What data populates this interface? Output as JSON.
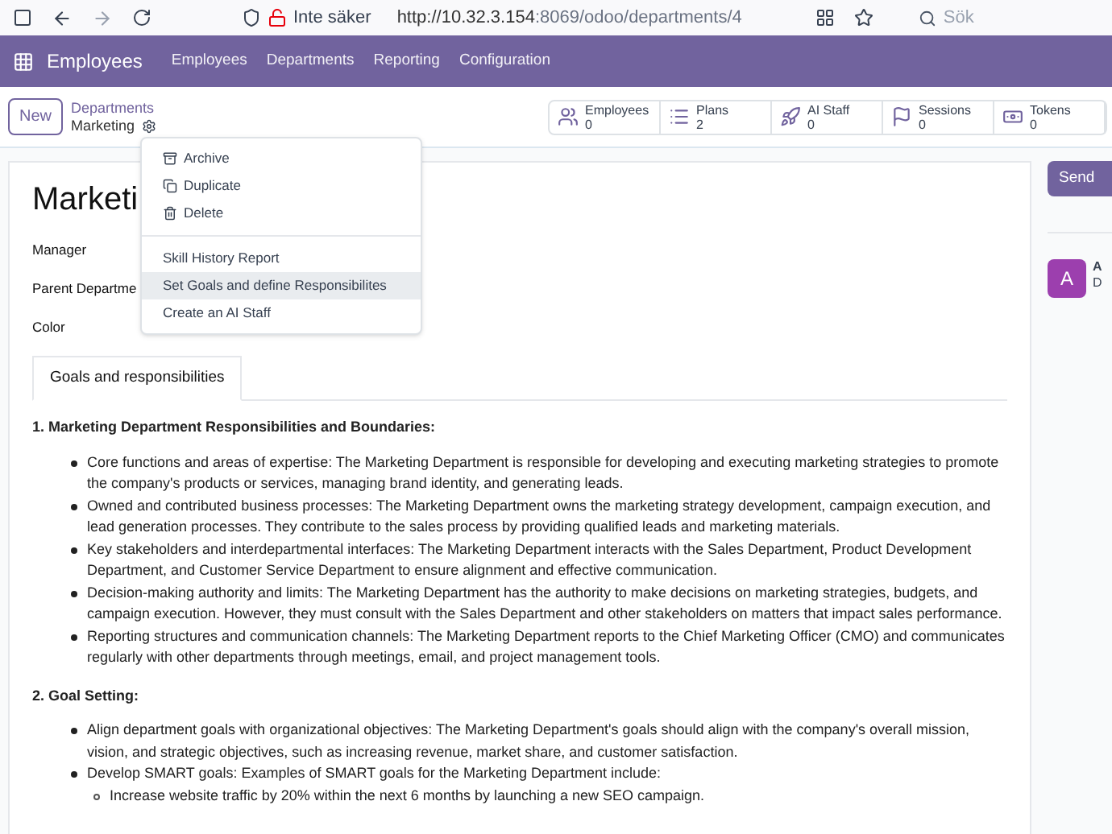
{
  "browser": {
    "security": "Inte säker",
    "url_host": "http://10.32.3.154",
    "url_rest": ":8069/odoo/departments/4",
    "search_placeholder": "Sök"
  },
  "navbar": {
    "app": "Employees",
    "menu": [
      "Employees",
      "Departments",
      "Reporting",
      "Configuration"
    ]
  },
  "control_panel": {
    "new_button": "New",
    "breadcrumb_parent": "Departments",
    "breadcrumb_current": "Marketing",
    "stats": [
      {
        "kind": "people",
        "label": "Employees",
        "value": "0"
      },
      {
        "kind": "list",
        "label": "Plans",
        "value": "2"
      },
      {
        "kind": "rocket",
        "label": "AI Staff",
        "value": "0"
      },
      {
        "kind": "flag",
        "label": "Sessions",
        "value": "0"
      },
      {
        "kind": "money",
        "label": "Tokens",
        "value": "0"
      }
    ]
  },
  "action_menu": [
    {
      "kind": "archive",
      "label": "Archive",
      "selected": false
    },
    {
      "kind": "duplicate",
      "label": "Duplicate",
      "selected": false
    },
    {
      "kind": "delete",
      "label": "Delete",
      "selected": false
    },
    {
      "kind": "divider"
    },
    {
      "kind": "plain",
      "label": "Skill History Report",
      "selected": false
    },
    {
      "kind": "plain",
      "label": "Set Goals and define Responsibilites",
      "selected": true
    },
    {
      "kind": "plain",
      "label": "Create an AI Staff",
      "selected": false
    }
  ],
  "form": {
    "title": "Marketi",
    "fields": [
      "Manager",
      "Parent Departme",
      "Color"
    ],
    "tabs": [
      {
        "label": "Goals and responsibilities",
        "selected": true
      }
    ]
  },
  "content": [
    {
      "heading": "1. Marketing Department Responsibilities and Boundaries:",
      "items": [
        {
          "text": "Core functions and areas of expertise: The Marketing Department is responsible for developing and executing marketing strategies to promote the company's products or services, managing brand identity, and generating leads."
        },
        {
          "text": "Owned and contributed business processes: The Marketing Department owns the marketing strategy development, campaign execution, and lead generation processes. They contribute to the sales process by providing qualified leads and marketing materials."
        },
        {
          "text": "Key stakeholders and interdepartmental interfaces: The Marketing Department interacts with the Sales Department, Product Development Department, and Customer Service Department to ensure alignment and effective communication."
        },
        {
          "text": "Decision-making authority and limits: The Marketing Department has the authority to make decisions on marketing strategies, budgets, and campaign execution. However, they must consult with the Sales Department and other stakeholders on matters that impact sales performance."
        },
        {
          "text": "Reporting structures and communication channels: The Marketing Department reports to the Chief Marketing Officer (CMO) and communicates regularly with other departments through meetings, email, and project management tools."
        }
      ]
    },
    {
      "heading": "2. Goal Setting:",
      "items": [
        {
          "text": "Align department goals with organizational objectives: The Marketing Department's goals should align with the company's overall mission, vision, and strategic objectives, such as increasing revenue, market share, and customer satisfaction."
        },
        {
          "text": "Develop SMART goals: Examples of SMART goals for the Marketing Department include:",
          "children": [
            {
              "text": "Increase website traffic by 20% within the next 6 months by launching a new SEO campaign."
            }
          ]
        }
      ]
    }
  ],
  "chatter": {
    "send_button": "Send",
    "avatar_letter": "A",
    "author": "A",
    "line": "D"
  }
}
